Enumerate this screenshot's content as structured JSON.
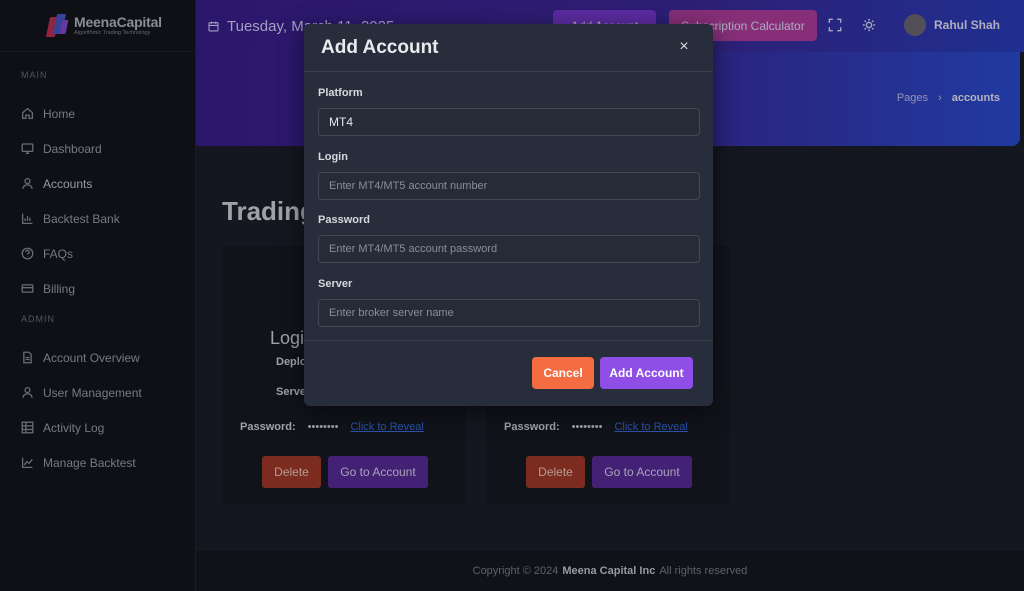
{
  "brand": {
    "name": "MeenaCapital",
    "tagline": "Algorithmic Trading Technology"
  },
  "sidebar": {
    "main_label": "MAIN",
    "admin_label": "ADMIN",
    "main_items": [
      {
        "label": "Home",
        "icon": "home-icon"
      },
      {
        "label": "Dashboard",
        "icon": "monitor-icon"
      },
      {
        "label": "Accounts",
        "icon": "user-icon"
      },
      {
        "label": "Backtest Bank",
        "icon": "chart-icon"
      },
      {
        "label": "FAQs",
        "icon": "help-icon"
      },
      {
        "label": "Billing",
        "icon": "card-icon"
      }
    ],
    "admin_items": [
      {
        "label": "Account Overview",
        "icon": "file-icon"
      },
      {
        "label": "User Management",
        "icon": "user-icon"
      },
      {
        "label": "Activity Log",
        "icon": "grid-icon"
      },
      {
        "label": "Manage Backtest",
        "icon": "chart-line-icon"
      }
    ]
  },
  "header": {
    "date": "Tuesday, March 11, 2025",
    "add_account": "Add Account",
    "subscription_calculator": "Subscription Calculator",
    "user_name": "Rahul Shah"
  },
  "breadcrumb": {
    "parent": "Pages",
    "separator": "›",
    "current": "accounts"
  },
  "page": {
    "title": "Trading Accounts"
  },
  "cards": [
    {
      "login": "Login",
      "deploy_label": "Deplo",
      "server_label": "Serve",
      "password_label": "Password:",
      "password_mask": "••••••••",
      "reveal": "Click to Reveal",
      "delete": "Delete",
      "go": "Go to Account"
    },
    {
      "password_label": "Password:",
      "password_mask": "••••••••",
      "reveal": "Click to Reveal",
      "delete": "Delete",
      "go": "Go to Account"
    }
  ],
  "footer": {
    "prefix": "Copyright © 2024",
    "company": "Meena Capital Inc",
    "suffix": "All rights reserved"
  },
  "modal": {
    "title": "Add Account",
    "close": "×",
    "platform_label": "Platform",
    "platform_value": "MT4",
    "login_label": "Login",
    "login_placeholder": "Enter MT4/MT5 account number",
    "password_label": "Password",
    "password_placeholder": "Enter MT4/MT5 account password",
    "server_label": "Server",
    "server_placeholder": "Enter broker server name",
    "cancel": "Cancel",
    "submit": "Add Account"
  },
  "colors": {
    "accent": "#8f4fe6",
    "cancel": "#f36c42",
    "danger": "#a63a2a",
    "header_gradient_start": "#3a1f8f",
    "header_gradient_end": "#2b4ed6"
  }
}
